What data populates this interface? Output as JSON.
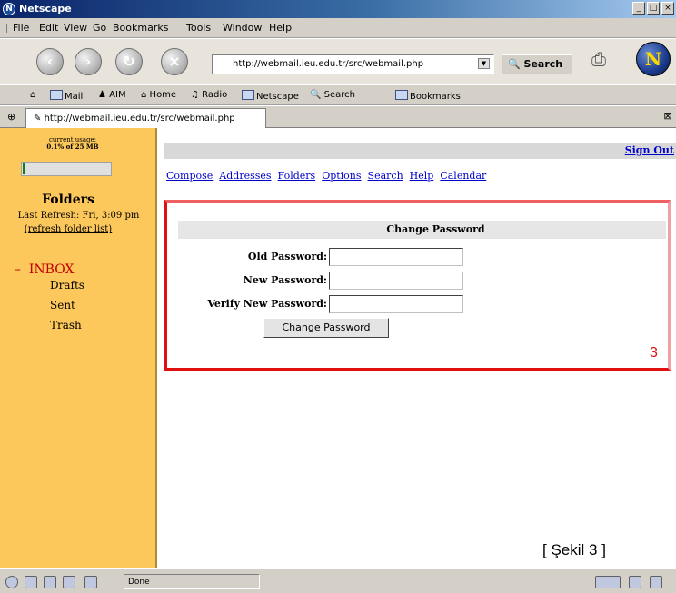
{
  "window": {
    "title": "Netscape",
    "app_icon": "netscape-icon",
    "min": "_",
    "max": "□",
    "close": "×"
  },
  "menu": [
    "File",
    "Edit",
    "View",
    "Go",
    "Bookmarks",
    "Tools",
    "Window",
    "Help"
  ],
  "navigation": {
    "url": "http://webmail.ieu.edu.tr/src/webmail.php",
    "search_label": "Search",
    "throbber_letter": "N"
  },
  "personal_toolbar": [
    "Mail",
    "AIM",
    "Home",
    "Radio",
    "Netscape",
    "Search",
    "Bookmarks"
  ],
  "tab": {
    "url": "http://webmail.ieu.edu.tr/src/webmail.php"
  },
  "sidebar": {
    "usage_label": "current usage:",
    "usage_value": "0.1% of 25 MB",
    "usage_fraction": 0.01,
    "folders_title": "Folders",
    "last_refresh": "Last Refresh: Fri, 3:09 pm",
    "refresh_link": "(refresh folder list)",
    "inbox_marker": "–",
    "inbox": "INBOX",
    "subfolders": [
      "Drafts",
      "Sent",
      "Trash"
    ]
  },
  "main": {
    "sign_out": "Sign Out",
    "nav_links": [
      "Compose",
      "Addresses",
      "Folders",
      "Options",
      "Search",
      "Help",
      "Calendar"
    ],
    "change_password": {
      "header": "Change Password",
      "fields": [
        {
          "label": "Old Password:",
          "value": ""
        },
        {
          "label": "New Password:",
          "value": ""
        },
        {
          "label": "Verify New Password:",
          "value": ""
        }
      ],
      "button": "Change Password"
    },
    "step_number": "3",
    "caption": "[ Şekil 3 ]"
  },
  "status": {
    "text": "Done"
  },
  "colors": {
    "sidebar_bg": "#fcc75b",
    "link": "#0000cc",
    "highlight_frame": "#e01010",
    "inbox": "#c00000"
  }
}
